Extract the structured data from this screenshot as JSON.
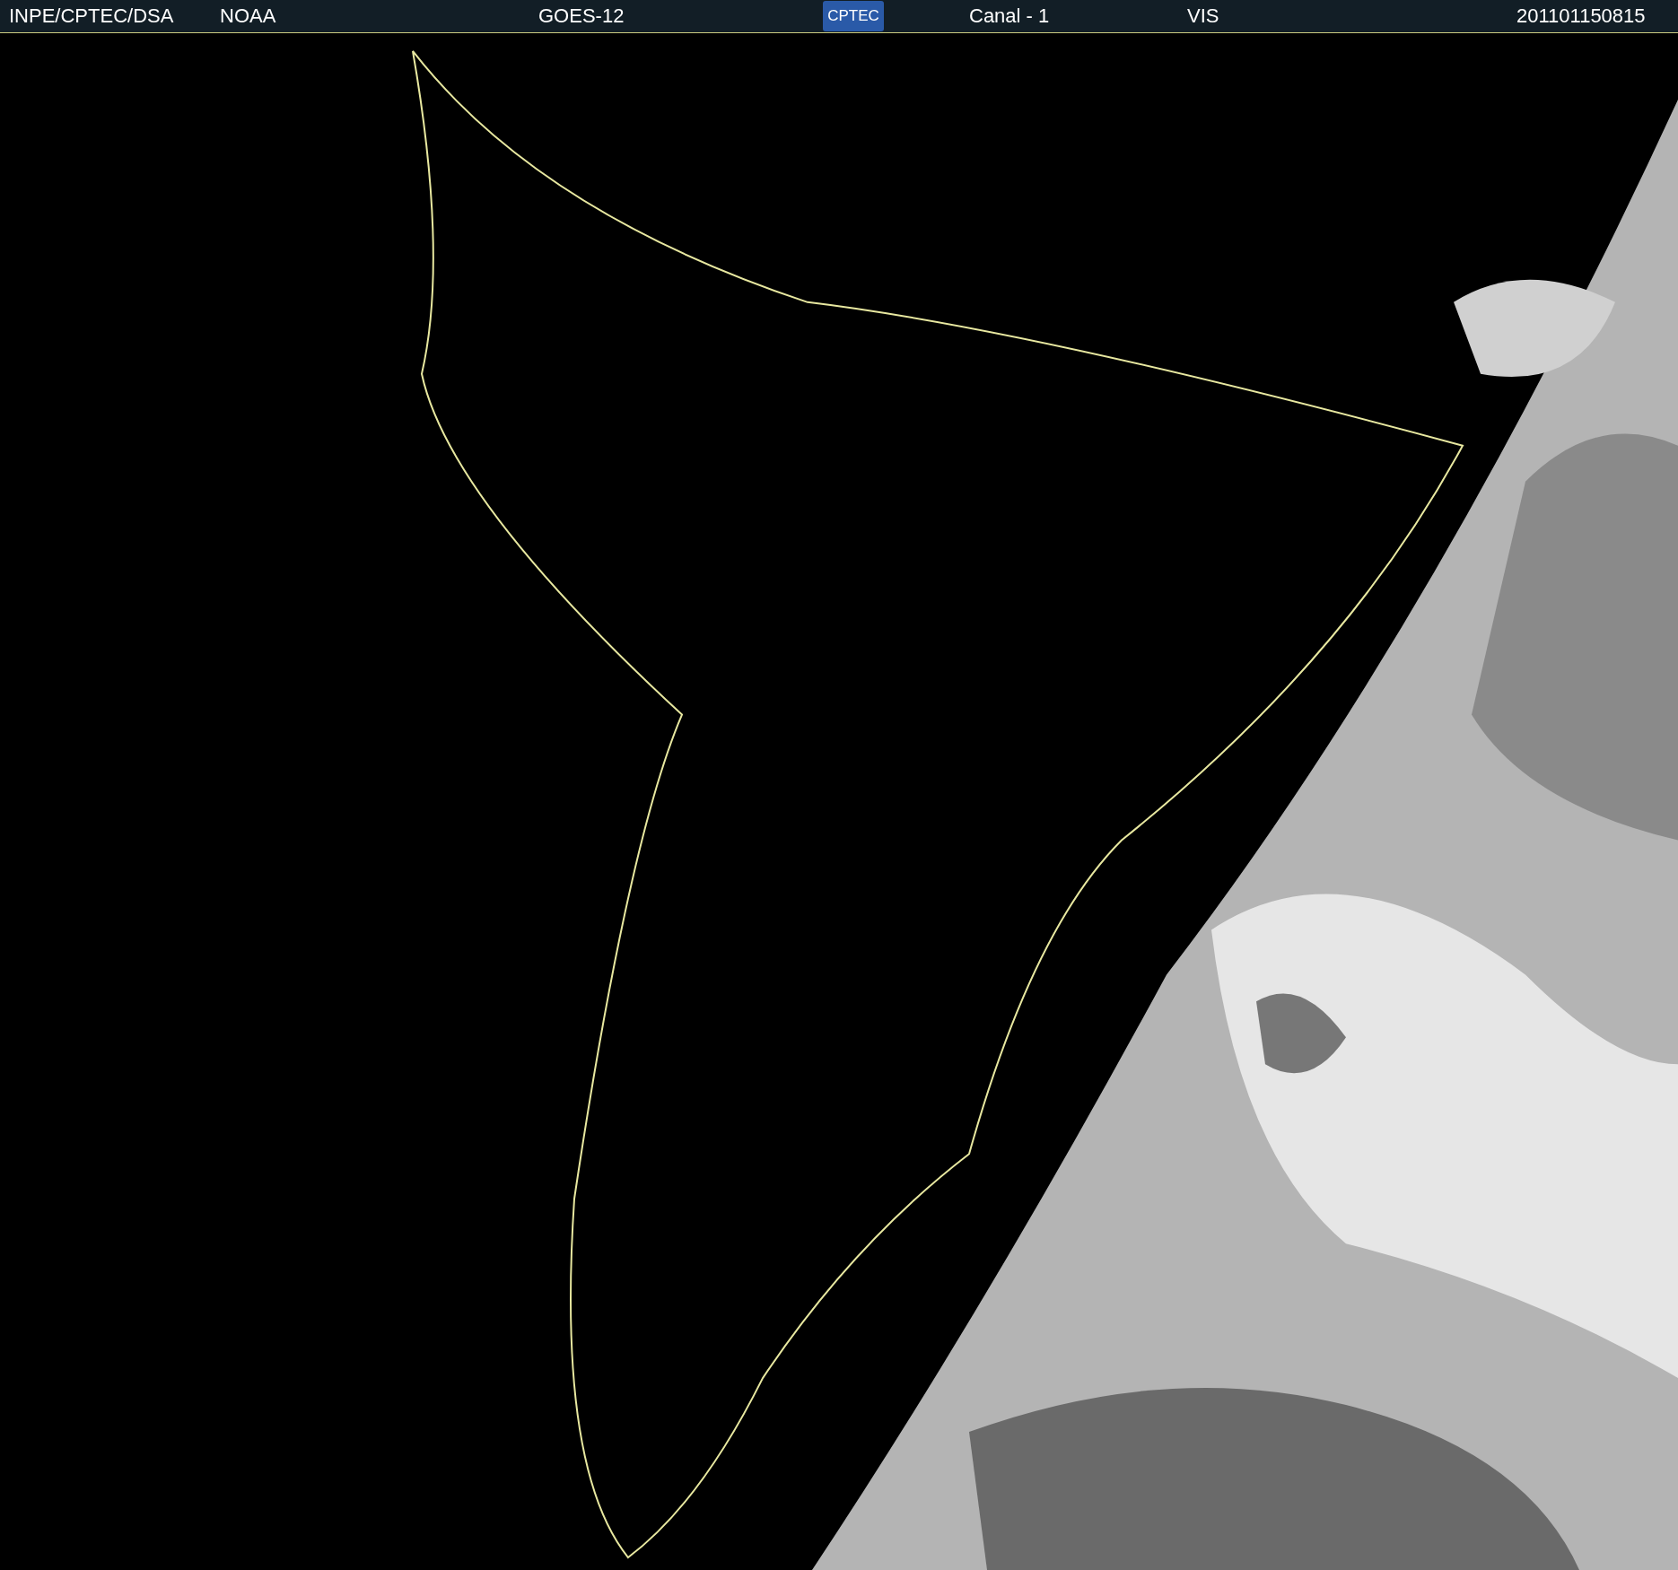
{
  "header": {
    "source": "INPE/CPTEC/DSA",
    "agency": "NOAA",
    "satellite": "GOES-12",
    "logo": "CPTEC",
    "channel": "Canal - 1",
    "band": "VIS",
    "timestamp": "201101150815"
  }
}
